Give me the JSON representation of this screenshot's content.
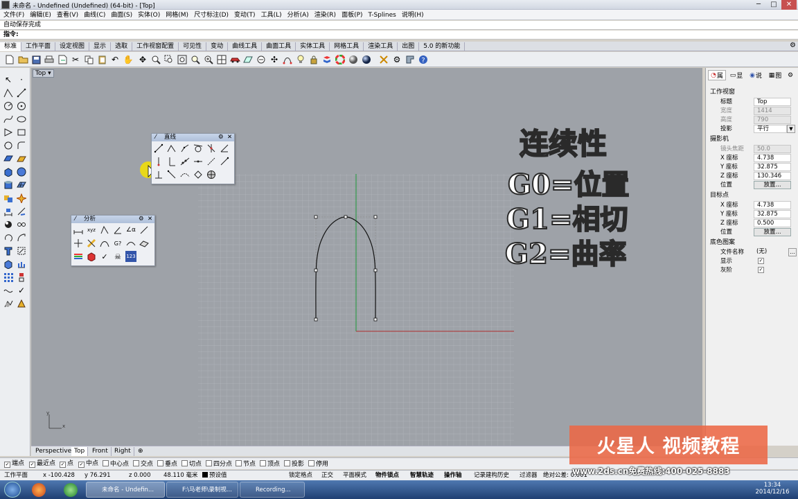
{
  "window": {
    "title": "未命名 - Undefined (Undefined) (64-bit) - [Top]",
    "controls": [
      "─",
      "□",
      "✕"
    ]
  },
  "menu": [
    "文件(F)",
    "编辑(E)",
    "查看(V)",
    "曲线(C)",
    "曲面(S)",
    "实体(O)",
    "网格(M)",
    "尺寸标注(D)",
    "变动(T)",
    "工具(L)",
    "分析(A)",
    "渲染(R)",
    "面板(P)",
    "T-Splines",
    "说明(H)"
  ],
  "command": {
    "history": "自动保存完成",
    "prompt": "指令:"
  },
  "tabs": [
    "标准",
    "工作平面",
    "设定视图",
    "显示",
    "选取",
    "工作视窗配置",
    "可见性",
    "变动",
    "曲线工具",
    "曲面工具",
    "实体工具",
    "网格工具",
    "渲染工具",
    "出图",
    "5.0 的新功能"
  ],
  "viewport": {
    "label": "Top",
    "annotation": {
      "title": "连续性",
      "g0": "G0=位置",
      "g1": "G1=相切",
      "g2": "G2=曲率"
    }
  },
  "float_panels": {
    "line": {
      "title": "直线"
    },
    "analysis": {
      "title": "分析"
    }
  },
  "properties": {
    "tabs": [
      "属",
      "显",
      "说",
      "图"
    ],
    "section_viewport": "工作视窗",
    "title_label": "标题",
    "title_value": "Top",
    "width_label": "宽度",
    "width_value": "1414",
    "height_label": "高度",
    "height_value": "790",
    "projection_label": "投影",
    "projection_value": "平行",
    "section_camera": "摄影机",
    "lens_label": "镜头焦距",
    "lens_value": "50.0",
    "cam_x_label": "X 座标",
    "cam_x_value": "4.738",
    "cam_y_label": "Y 座标",
    "cam_y_value": "32.875",
    "cam_z_label": "Z 座标",
    "cam_z_value": "130.346",
    "cam_pos_label": "位置",
    "cam_pos_button": "放置...",
    "section_target": "目标点",
    "tgt_x_label": "X 座标",
    "tgt_x_value": "4.738",
    "tgt_y_label": "Y 座标",
    "tgt_y_value": "32.875",
    "tgt_z_label": "Z 座标",
    "tgt_z_value": "0.500",
    "tgt_pos_label": "位置",
    "tgt_pos_button": "放置...",
    "section_wallpaper": "底色图案",
    "file_label": "文件名称",
    "file_value": "(无)",
    "show_label": "显示",
    "gray_label": "灰阶"
  },
  "osnap": [
    {
      "label": "端点",
      "checked": true
    },
    {
      "label": "最近点",
      "checked": true
    },
    {
      "label": "点",
      "checked": true
    },
    {
      "label": "中点",
      "checked": true
    },
    {
      "label": "中心点",
      "checked": false
    },
    {
      "label": "交点",
      "checked": false
    },
    {
      "label": "垂点",
      "checked": false
    },
    {
      "label": "切点",
      "checked": false
    },
    {
      "label": "四分点",
      "checked": false
    },
    {
      "label": "节点",
      "checked": false
    },
    {
      "label": "顶点",
      "checked": false
    },
    {
      "label": "投影",
      "checked": false
    },
    {
      "label": "停用",
      "checked": false
    }
  ],
  "status": {
    "plane": "工作平面",
    "x": "x -100.428",
    "y": "y 76.291",
    "z": "z 0.000",
    "unit": "48.110 毫米",
    "layer": "预设值",
    "modes": [
      "锁定格点",
      "正交",
      "平面模式",
      "物件锁点",
      "智慧轨迹",
      "操作轴",
      "记录建构历史",
      "过滤器"
    ],
    "tolerance": "绝对公差: 0.001"
  },
  "viewport_tabs": [
    "Perspective",
    "Top",
    "Front",
    "Right",
    "⊕"
  ],
  "taskbar": {
    "items": [
      "未命名 - Undefin...",
      "F:\\马老师\\录制视...",
      "Recording..."
    ],
    "time": "13:34",
    "date": "2014/12/16"
  },
  "watermark": {
    "text": "火星人 视频教程",
    "url": "www.2ds.cn免费热线:400-025-8883"
  },
  "colors": {
    "viewport_bg": "#9ea2a8",
    "grid": "#a9adb3",
    "x_axis": "#b03030",
    "y_axis": "#1f9a3a",
    "curve": "#111111",
    "watermark": "#ec6846"
  }
}
